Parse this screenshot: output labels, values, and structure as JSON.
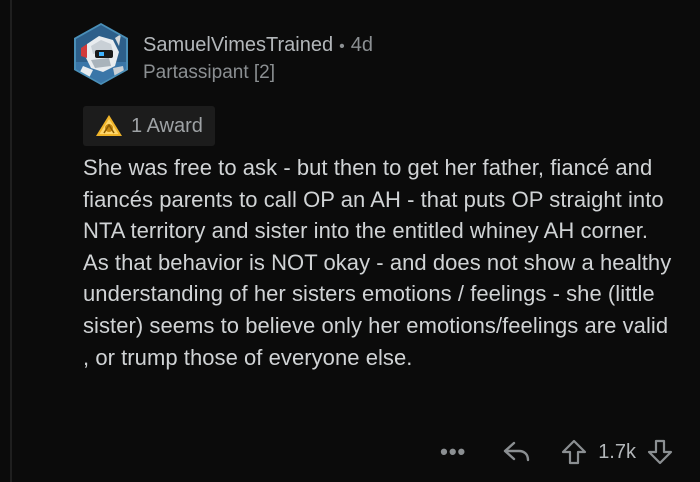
{
  "comment": {
    "author": "SamuelVimesTrained",
    "separator": "•",
    "age": "4d",
    "flair": "Partassipant [2]",
    "award": {
      "icon": "award-medal-icon",
      "label": "1 Award"
    },
    "body": "She was free to ask - but then to get her father, fiancé and fiancés parents to call OP an AH - that puts OP straight into NTA territory and sister into the entitled whiney AH corner. As that behavior is NOT okay - and does not show a healthy understanding of her sisters emotions / feelings - she (little sister) seems to believe only her emotions/feelings are valid , or trump those of everyone else.",
    "actions": {
      "more_label": "•••",
      "reply_icon": "reply-icon",
      "upvote_icon": "upvote-arrow-icon",
      "score": "1.7k",
      "downvote_icon": "downvote-arrow-icon"
    }
  },
  "colors": {
    "background": "#0b0b0b",
    "text": "#d0d3d5",
    "muted": "#8b8f92",
    "award_chip": "#1c1c1c",
    "avatar_ring": "#4a8fb8"
  }
}
